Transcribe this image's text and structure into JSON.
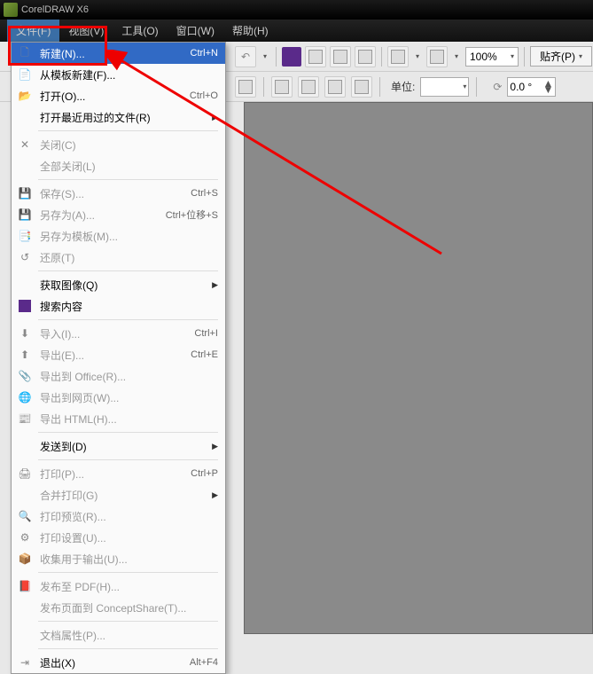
{
  "titlebar": {
    "title": "CorelDRAW X6"
  },
  "menubar": {
    "file": "文件(F)",
    "view": "视图(V)",
    "tools": "工具(O)",
    "window": "窗口(W)",
    "help": "帮助(H)"
  },
  "toolbar": {
    "zoom": "100%",
    "paste": "贴齐(P)",
    "unit_label": "单位:",
    "rotation": "0.0 °"
  },
  "dropdown": {
    "new": {
      "label": "新建(N)...",
      "shortcut": "Ctrl+N"
    },
    "new_template": {
      "label": "从模板新建(F)..."
    },
    "open": {
      "label": "打开(O)...",
      "shortcut": "Ctrl+O"
    },
    "open_recent": {
      "label": "打开最近用过的文件(R)"
    },
    "close": {
      "label": "关闭(C)"
    },
    "close_all": {
      "label": "全部关闭(L)"
    },
    "save": {
      "label": "保存(S)...",
      "shortcut": "Ctrl+S"
    },
    "save_as": {
      "label": "另存为(A)...",
      "shortcut": "Ctrl+位移+S"
    },
    "save_template": {
      "label": "另存为模板(M)..."
    },
    "revert": {
      "label": "还原(T)"
    },
    "acquire": {
      "label": "获取图像(Q)"
    },
    "search": {
      "label": "搜索内容"
    },
    "import": {
      "label": "导入(I)...",
      "shortcut": "Ctrl+I"
    },
    "export": {
      "label": "导出(E)...",
      "shortcut": "Ctrl+E"
    },
    "export_office": {
      "label": "导出到 Office(R)..."
    },
    "export_web": {
      "label": "导出到网页(W)..."
    },
    "export_html": {
      "label": "导出 HTML(H)..."
    },
    "send_to": {
      "label": "发送到(D)"
    },
    "print": {
      "label": "打印(P)...",
      "shortcut": "Ctrl+P"
    },
    "print_merge": {
      "label": "合并打印(G)"
    },
    "print_preview": {
      "label": "打印预览(R)..."
    },
    "print_setup": {
      "label": "打印设置(U)..."
    },
    "collect_output": {
      "label": "收集用于输出(U)..."
    },
    "publish_pdf": {
      "label": "发布至 PDF(H)..."
    },
    "publish_concept": {
      "label": "发布页面到 ConceptShare(T)..."
    },
    "doc_properties": {
      "label": "文档属性(P)..."
    },
    "exit": {
      "label": "退出(X)",
      "shortcut": "Alt+F4"
    }
  }
}
